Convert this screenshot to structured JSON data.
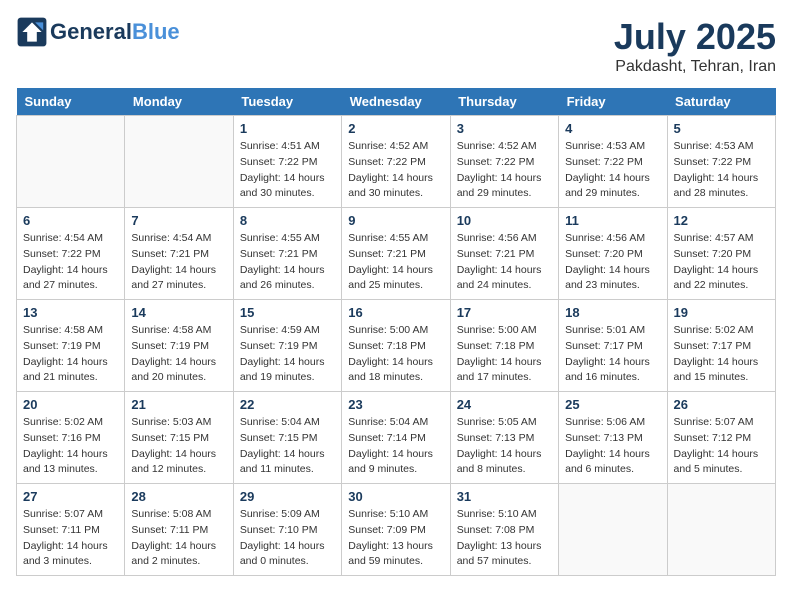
{
  "header": {
    "logo_general": "General",
    "logo_blue": "Blue",
    "month_title": "July 2025",
    "location": "Pakdasht, Tehran, Iran"
  },
  "days_of_week": [
    "Sunday",
    "Monday",
    "Tuesday",
    "Wednesday",
    "Thursday",
    "Friday",
    "Saturday"
  ],
  "weeks": [
    [
      {
        "day": "",
        "empty": true
      },
      {
        "day": "",
        "empty": true
      },
      {
        "day": "1",
        "sunrise": "4:51 AM",
        "sunset": "7:22 PM",
        "daylight": "14 hours and 30 minutes."
      },
      {
        "day": "2",
        "sunrise": "4:52 AM",
        "sunset": "7:22 PM",
        "daylight": "14 hours and 30 minutes."
      },
      {
        "day": "3",
        "sunrise": "4:52 AM",
        "sunset": "7:22 PM",
        "daylight": "14 hours and 29 minutes."
      },
      {
        "day": "4",
        "sunrise": "4:53 AM",
        "sunset": "7:22 PM",
        "daylight": "14 hours and 29 minutes."
      },
      {
        "day": "5",
        "sunrise": "4:53 AM",
        "sunset": "7:22 PM",
        "daylight": "14 hours and 28 minutes."
      }
    ],
    [
      {
        "day": "6",
        "sunrise": "4:54 AM",
        "sunset": "7:22 PM",
        "daylight": "14 hours and 27 minutes."
      },
      {
        "day": "7",
        "sunrise": "4:54 AM",
        "sunset": "7:21 PM",
        "daylight": "14 hours and 27 minutes."
      },
      {
        "day": "8",
        "sunrise": "4:55 AM",
        "sunset": "7:21 PM",
        "daylight": "14 hours and 26 minutes."
      },
      {
        "day": "9",
        "sunrise": "4:55 AM",
        "sunset": "7:21 PM",
        "daylight": "14 hours and 25 minutes."
      },
      {
        "day": "10",
        "sunrise": "4:56 AM",
        "sunset": "7:21 PM",
        "daylight": "14 hours and 24 minutes."
      },
      {
        "day": "11",
        "sunrise": "4:56 AM",
        "sunset": "7:20 PM",
        "daylight": "14 hours and 23 minutes."
      },
      {
        "day": "12",
        "sunrise": "4:57 AM",
        "sunset": "7:20 PM",
        "daylight": "14 hours and 22 minutes."
      }
    ],
    [
      {
        "day": "13",
        "sunrise": "4:58 AM",
        "sunset": "7:19 PM",
        "daylight": "14 hours and 21 minutes."
      },
      {
        "day": "14",
        "sunrise": "4:58 AM",
        "sunset": "7:19 PM",
        "daylight": "14 hours and 20 minutes."
      },
      {
        "day": "15",
        "sunrise": "4:59 AM",
        "sunset": "7:19 PM",
        "daylight": "14 hours and 19 minutes."
      },
      {
        "day": "16",
        "sunrise": "5:00 AM",
        "sunset": "7:18 PM",
        "daylight": "14 hours and 18 minutes."
      },
      {
        "day": "17",
        "sunrise": "5:00 AM",
        "sunset": "7:18 PM",
        "daylight": "14 hours and 17 minutes."
      },
      {
        "day": "18",
        "sunrise": "5:01 AM",
        "sunset": "7:17 PM",
        "daylight": "14 hours and 16 minutes."
      },
      {
        "day": "19",
        "sunrise": "5:02 AM",
        "sunset": "7:17 PM",
        "daylight": "14 hours and 15 minutes."
      }
    ],
    [
      {
        "day": "20",
        "sunrise": "5:02 AM",
        "sunset": "7:16 PM",
        "daylight": "14 hours and 13 minutes."
      },
      {
        "day": "21",
        "sunrise": "5:03 AM",
        "sunset": "7:15 PM",
        "daylight": "14 hours and 12 minutes."
      },
      {
        "day": "22",
        "sunrise": "5:04 AM",
        "sunset": "7:15 PM",
        "daylight": "14 hours and 11 minutes."
      },
      {
        "day": "23",
        "sunrise": "5:04 AM",
        "sunset": "7:14 PM",
        "daylight": "14 hours and 9 minutes."
      },
      {
        "day": "24",
        "sunrise": "5:05 AM",
        "sunset": "7:13 PM",
        "daylight": "14 hours and 8 minutes."
      },
      {
        "day": "25",
        "sunrise": "5:06 AM",
        "sunset": "7:13 PM",
        "daylight": "14 hours and 6 minutes."
      },
      {
        "day": "26",
        "sunrise": "5:07 AM",
        "sunset": "7:12 PM",
        "daylight": "14 hours and 5 minutes."
      }
    ],
    [
      {
        "day": "27",
        "sunrise": "5:07 AM",
        "sunset": "7:11 PM",
        "daylight": "14 hours and 3 minutes."
      },
      {
        "day": "28",
        "sunrise": "5:08 AM",
        "sunset": "7:11 PM",
        "daylight": "14 hours and 2 minutes."
      },
      {
        "day": "29",
        "sunrise": "5:09 AM",
        "sunset": "7:10 PM",
        "daylight": "14 hours and 0 minutes."
      },
      {
        "day": "30",
        "sunrise": "5:10 AM",
        "sunset": "7:09 PM",
        "daylight": "13 hours and 59 minutes."
      },
      {
        "day": "31",
        "sunrise": "5:10 AM",
        "sunset": "7:08 PM",
        "daylight": "13 hours and 57 minutes."
      },
      {
        "day": "",
        "empty": true
      },
      {
        "day": "",
        "empty": true
      }
    ]
  ]
}
